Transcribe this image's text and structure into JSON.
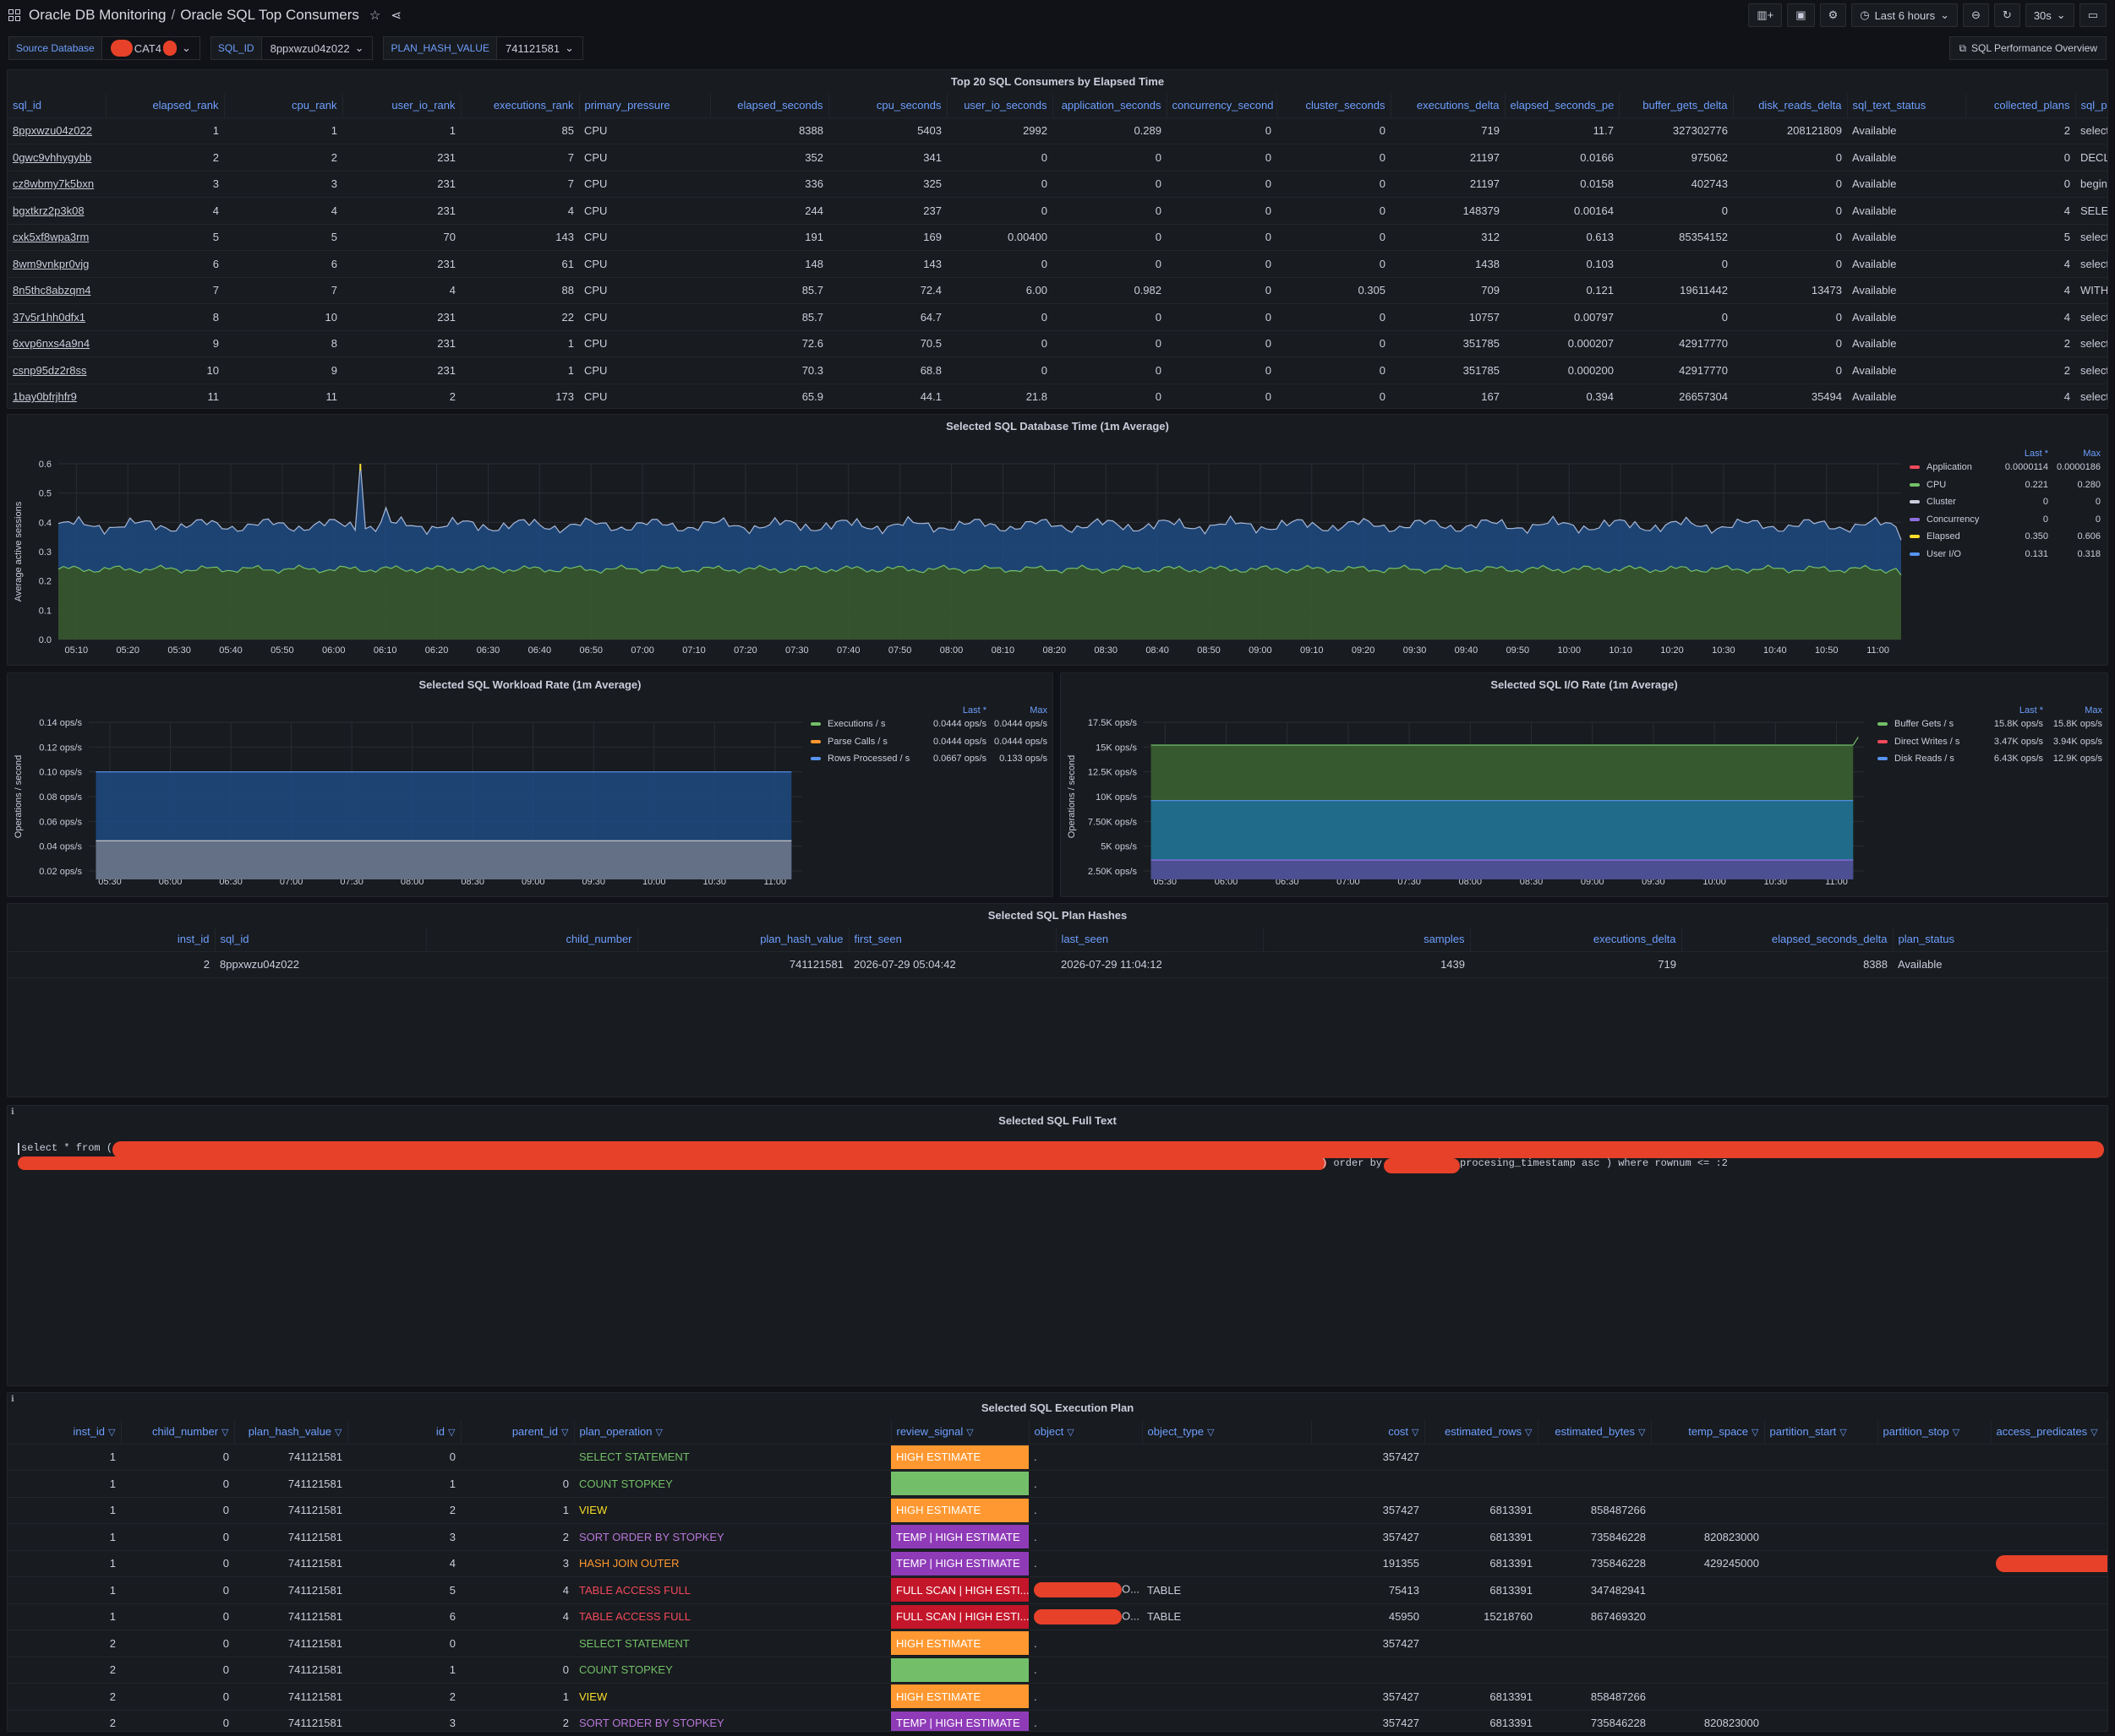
{
  "header": {
    "folder": "Oracle DB Monitoring",
    "dashboard": "Oracle SQL Top Consumers",
    "time_range": "Last 6 hours",
    "refresh": "30s"
  },
  "variables": {
    "source_db_label": "Source Database",
    "source_db_value": "CAT4",
    "sql_id_label": "SQL_ID",
    "sql_id_value": "8ppxwzu04z022",
    "plan_hash_label": "PLAN_HASH_VALUE",
    "plan_hash_value": "741121581"
  },
  "perf_link": "SQL Performance Overview",
  "top_consumers": {
    "title": "Top 20 SQL Consumers by Elapsed Time",
    "columns": [
      "sql_id",
      "elapsed_rank",
      "cpu_rank",
      "user_io_rank",
      "executions_rank",
      "primary_pressure",
      "elapsed_seconds",
      "cpu_seconds",
      "user_io_seconds",
      "application_seconds",
      "concurrency_second",
      "cluster_seconds",
      "executions_delta",
      "elapsed_seconds_pe",
      "buffer_gets_delta",
      "disk_reads_delta",
      "sql_text_status",
      "collected_plans",
      "sql_previ"
    ],
    "rows": [
      [
        "8ppxwzu04z022",
        "1",
        "1",
        "1",
        "85",
        "CPU",
        "8388",
        "5403",
        "2992",
        "0.289",
        "0",
        "0",
        "719",
        "11.7",
        "327302776",
        "208121809",
        "Available",
        "2",
        "select * fr"
      ],
      [
        "0gwc9vhhygybb",
        "2",
        "2",
        "231",
        "7",
        "CPU",
        "352",
        "341",
        "0",
        "0",
        "0",
        "0",
        "21197",
        "0.0166",
        "975062",
        "0",
        "Available",
        "0",
        "DECLARE"
      ],
      [
        "cz8wbmy7k5bxn",
        "3",
        "3",
        "231",
        "7",
        "CPU",
        "336",
        "325",
        "0",
        "0",
        "0",
        "0",
        "21197",
        "0.0158",
        "402743",
        "0",
        "Available",
        "0",
        "begin sys."
      ],
      [
        "bgxtkrz2p3k08",
        "4",
        "4",
        "231",
        "4",
        "CPU",
        "244",
        "237",
        "0",
        "0",
        "0",
        "0",
        "148379",
        "0.00164",
        "0",
        "0",
        "Available",
        "4",
        "SELECT V"
      ],
      [
        "cxk5xf8wpa3rm",
        "5",
        "5",
        "70",
        "143",
        "CPU",
        "191",
        "169",
        "0.00400",
        "0",
        "0",
        "0",
        "312",
        "0.613",
        "85354152",
        "0",
        "Available",
        "5",
        "select dt.t"
      ],
      [
        "8wm9vnkpr0vjg",
        "6",
        "6",
        "231",
        "61",
        "CPU",
        "148",
        "143",
        "0",
        "0",
        "0",
        "0",
        "1438",
        "0.103",
        "0",
        "0",
        "Available",
        "4",
        "select q.in"
      ],
      [
        "8n5thc8abzqm4",
        "7",
        "7",
        "4",
        "88",
        "CPU",
        "85.7",
        "72.4",
        "6.00",
        "0.982",
        "0",
        "0.305",
        "709",
        "0.121",
        "19611442",
        "13473",
        "Available",
        "4",
        "WITH MO"
      ],
      [
        "37v5r1hh0dfx1",
        "8",
        "10",
        "231",
        "22",
        "CPU",
        "85.7",
        "64.7",
        "0",
        "0",
        "0",
        "0",
        "10757",
        "0.00797",
        "0",
        "0",
        "Available",
        "4",
        "select s.in"
      ],
      [
        "6xvp6nxs4a9n4",
        "9",
        "8",
        "231",
        "1",
        "CPU",
        "72.6",
        "70.5",
        "0",
        "0",
        "0",
        "0",
        "351785",
        "0.000207",
        "42917770",
        "0",
        "Available",
        "2",
        "select nvl("
      ],
      [
        "csnp95dz2r8ss",
        "10",
        "9",
        "231",
        "1",
        "CPU",
        "70.3",
        "68.8",
        "0",
        "0",
        "0",
        "0",
        "351785",
        "0.000200",
        "42917770",
        "0",
        "Available",
        "2",
        "select file"
      ],
      [
        "1bay0bfrjhfr9",
        "11",
        "11",
        "2",
        "173",
        "CPU",
        "65.9",
        "44.1",
        "21.8",
        "0",
        "0",
        "0",
        "167",
        "0.394",
        "26657304",
        "35494",
        "Available",
        "4",
        "select inst"
      ]
    ]
  },
  "db_time": {
    "title": "Selected SQL Database Time (1m Average)",
    "ylabel": "Average active sessions",
    "legend_hdr": [
      "Last *",
      "Max"
    ],
    "legend": [
      {
        "name": "Application",
        "last": "0.0000114",
        "max": "0.0000186",
        "color": "#f2495c"
      },
      {
        "name": "CPU",
        "last": "0.221",
        "max": "0.280",
        "color": "#73bf69"
      },
      {
        "name": "Cluster",
        "last": "0",
        "max": "0",
        "color": "#ccccdc"
      },
      {
        "name": "Concurrency",
        "last": "0",
        "max": "0",
        "color": "#8f6fe0"
      },
      {
        "name": "Elapsed",
        "last": "0.350",
        "max": "0.606",
        "color": "#fade2a"
      },
      {
        "name": "User I/O",
        "last": "0.131",
        "max": "0.318",
        "color": "#5794f2"
      }
    ],
    "yticks": [
      "0.6",
      "0.5",
      "0.4",
      "0.3",
      "0.2",
      "0.1",
      "0.0"
    ],
    "xticks": [
      "05:10",
      "05:20",
      "05:30",
      "05:40",
      "05:50",
      "06:00",
      "06:10",
      "06:20",
      "06:30",
      "06:40",
      "06:50",
      "07:00",
      "07:10",
      "07:20",
      "07:30",
      "07:40",
      "07:50",
      "08:00",
      "08:10",
      "08:20",
      "08:30",
      "08:40",
      "08:50",
      "09:00",
      "09:10",
      "09:20",
      "09:30",
      "09:40",
      "09:50",
      "10:00",
      "10:10",
      "10:20",
      "10:30",
      "10:40",
      "10:50",
      "11:00"
    ]
  },
  "workload": {
    "title": "Selected SQL Workload Rate (1m Average)",
    "ylabel": "Operations / second",
    "legend_hdr": [
      "Last *",
      "Max"
    ],
    "legend": [
      {
        "name": "Executions / s",
        "last": "0.0444 ops/s",
        "max": "0.0444 ops/s",
        "color": "#73bf69"
      },
      {
        "name": "Parse Calls / s",
        "last": "0.0444 ops/s",
        "max": "0.0444 ops/s",
        "color": "#ff9830"
      },
      {
        "name": "Rows Processed / s",
        "last": "0.0667 ops/s",
        "max": "0.133 ops/s",
        "color": "#5794f2"
      }
    ],
    "yticks": [
      "0.14 ops/s",
      "0.12 ops/s",
      "0.10 ops/s",
      "0.08 ops/s",
      "0.06 ops/s",
      "0.04 ops/s",
      "0.02 ops/s"
    ],
    "xticks": [
      "05:30",
      "06:00",
      "06:30",
      "07:00",
      "07:30",
      "08:00",
      "08:30",
      "09:00",
      "09:30",
      "10:00",
      "10:30",
      "11:00"
    ]
  },
  "io_rate": {
    "title": "Selected SQL I/O Rate (1m Average)",
    "ylabel": "Operations / second",
    "legend_hdr": [
      "Last *",
      "Max"
    ],
    "legend": [
      {
        "name": "Buffer Gets / s",
        "last": "15.8K ops/s",
        "max": "15.8K ops/s",
        "color": "#73bf69"
      },
      {
        "name": "Direct Writes / s",
        "last": "3.47K ops/s",
        "max": "3.94K ops/s",
        "color": "#f2495c"
      },
      {
        "name": "Disk Reads / s",
        "last": "6.43K ops/s",
        "max": "12.9K ops/s",
        "color": "#5794f2"
      }
    ],
    "yticks": [
      "17.5K ops/s",
      "15K ops/s",
      "12.5K ops/s",
      "10K ops/s",
      "7.50K ops/s",
      "5K ops/s",
      "2.50K ops/s"
    ],
    "xticks": [
      "05:30",
      "06:00",
      "06:30",
      "07:00",
      "07:30",
      "08:00",
      "08:30",
      "09:00",
      "09:30",
      "10:00",
      "10:30",
      "11:00"
    ]
  },
  "plan_hashes": {
    "title": "Selected SQL Plan Hashes",
    "columns": [
      "inst_id",
      "sql_id",
      "child_number",
      "plan_hash_value",
      "first_seen",
      "last_seen",
      "samples",
      "executions_delta",
      "elapsed_seconds_delta",
      "plan_status"
    ],
    "rows": [
      [
        "2",
        "8ppxwzu04z022",
        "",
        "741121581",
        "2026-07-29 05:04:42",
        "2026-07-29 11:04:12",
        "1439",
        "719",
        "8388",
        "Available"
      ]
    ]
  },
  "full_text": {
    "title": "Selected SQL Full Text",
    "line1": "select * from (",
    "line2_mid": ") order by",
    "line2_end": "procesing_timestamp asc ) where rownum <= :2"
  },
  "exec_plan": {
    "title": "Selected SQL Execution Plan",
    "columns": [
      "inst_id",
      "child_number",
      "plan_hash_value",
      "id",
      "parent_id",
      "plan_operation",
      "review_signal",
      "object",
      "object_type",
      "cost",
      "estimated_rows",
      "estimated_bytes",
      "temp_space",
      "partition_start",
      "partition_stop",
      "access_predicates"
    ],
    "rows": [
      {
        "inst": "1",
        "child": "0",
        "phv": "741121581",
        "id": "0",
        "pid": "",
        "op": "SELECT STATEMENT",
        "opc": "#73bf69",
        "sig": "HIGH ESTIMATE",
        "sigc": "#ff9830",
        "obj": ".",
        "redobj": false,
        "otype": "",
        "cost": "357427",
        "rows": "",
        "bytes": "",
        "temp": "",
        "pred": false
      },
      {
        "inst": "1",
        "child": "0",
        "phv": "741121581",
        "id": "1",
        "pid": "0",
        "op": "COUNT STOPKEY",
        "opc": "#73bf69",
        "sig": "",
        "sigc": "#73bf69",
        "obj": ".",
        "redobj": false,
        "otype": "",
        "cost": "",
        "rows": "",
        "bytes": "",
        "temp": "",
        "pred": false
      },
      {
        "inst": "1",
        "child": "0",
        "phv": "741121581",
        "id": "2",
        "pid": "1",
        "op": "VIEW",
        "opc": "#fade2a",
        "sig": "HIGH ESTIMATE",
        "sigc": "#ff9830",
        "obj": ".",
        "redobj": false,
        "otype": "",
        "cost": "357427",
        "rows": "6813391",
        "bytes": "858487266",
        "temp": "",
        "pred": false
      },
      {
        "inst": "1",
        "child": "0",
        "phv": "741121581",
        "id": "3",
        "pid": "2",
        "op": "SORT ORDER BY STOPKEY",
        "opc": "#b877d9",
        "sig": "TEMP | HIGH ESTIMATE",
        "sigc": "#8f3bb8",
        "obj": ".",
        "redobj": false,
        "otype": "",
        "cost": "357427",
        "rows": "6813391",
        "bytes": "735846228",
        "temp": "820823000",
        "pred": false
      },
      {
        "inst": "1",
        "child": "0",
        "phv": "741121581",
        "id": "4",
        "pid": "3",
        "op": "HASH JOIN OUTER",
        "opc": "#ff9830",
        "sig": "TEMP | HIGH ESTIMATE",
        "sigc": "#8f3bb8",
        "obj": ".",
        "redobj": false,
        "otype": "",
        "cost": "191355",
        "rows": "6813391",
        "bytes": "735846228",
        "temp": "429245000",
        "pred": true
      },
      {
        "inst": "1",
        "child": "0",
        "phv": "741121581",
        "id": "5",
        "pid": "4",
        "op": "TABLE ACCESS FULL",
        "opc": "#f2495c",
        "sig": "FULL SCAN | HIGH ESTI...",
        "sigc": "#c4162a",
        "obj": "O...",
        "redobj": true,
        "otype": "TABLE",
        "cost": "75413",
        "rows": "6813391",
        "bytes": "347482941",
        "temp": "",
        "pred": false
      },
      {
        "inst": "1",
        "child": "0",
        "phv": "741121581",
        "id": "6",
        "pid": "4",
        "op": "TABLE ACCESS FULL",
        "opc": "#f2495c",
        "sig": "FULL SCAN | HIGH ESTI...",
        "sigc": "#c4162a",
        "obj": "O...",
        "redobj": true,
        "otype": "TABLE",
        "cost": "45950",
        "rows": "15218760",
        "bytes": "867469320",
        "temp": "",
        "pred": false
      },
      {
        "inst": "2",
        "child": "0",
        "phv": "741121581",
        "id": "0",
        "pid": "",
        "op": "SELECT STATEMENT",
        "opc": "#73bf69",
        "sig": "HIGH ESTIMATE",
        "sigc": "#ff9830",
        "obj": ".",
        "redobj": false,
        "otype": "",
        "cost": "357427",
        "rows": "",
        "bytes": "",
        "temp": "",
        "pred": false
      },
      {
        "inst": "2",
        "child": "0",
        "phv": "741121581",
        "id": "1",
        "pid": "0",
        "op": "COUNT STOPKEY",
        "opc": "#73bf69",
        "sig": "",
        "sigc": "#73bf69",
        "obj": ".",
        "redobj": false,
        "otype": "",
        "cost": "",
        "rows": "",
        "bytes": "",
        "temp": "",
        "pred": false
      },
      {
        "inst": "2",
        "child": "0",
        "phv": "741121581",
        "id": "2",
        "pid": "1",
        "op": "VIEW",
        "opc": "#fade2a",
        "sig": "HIGH ESTIMATE",
        "sigc": "#ff9830",
        "obj": ".",
        "redobj": false,
        "otype": "",
        "cost": "357427",
        "rows": "6813391",
        "bytes": "858487266",
        "temp": "",
        "pred": false
      },
      {
        "inst": "2",
        "child": "0",
        "phv": "741121581",
        "id": "3",
        "pid": "2",
        "op": "SORT ORDER BY STOPKEY",
        "opc": "#b877d9",
        "sig": "TEMP | HIGH ESTIMATE",
        "sigc": "#8f3bb8",
        "obj": ".",
        "redobj": false,
        "otype": "",
        "cost": "357427",
        "rows": "6813391",
        "bytes": "735846228",
        "temp": "820823000",
        "pred": false
      }
    ]
  }
}
